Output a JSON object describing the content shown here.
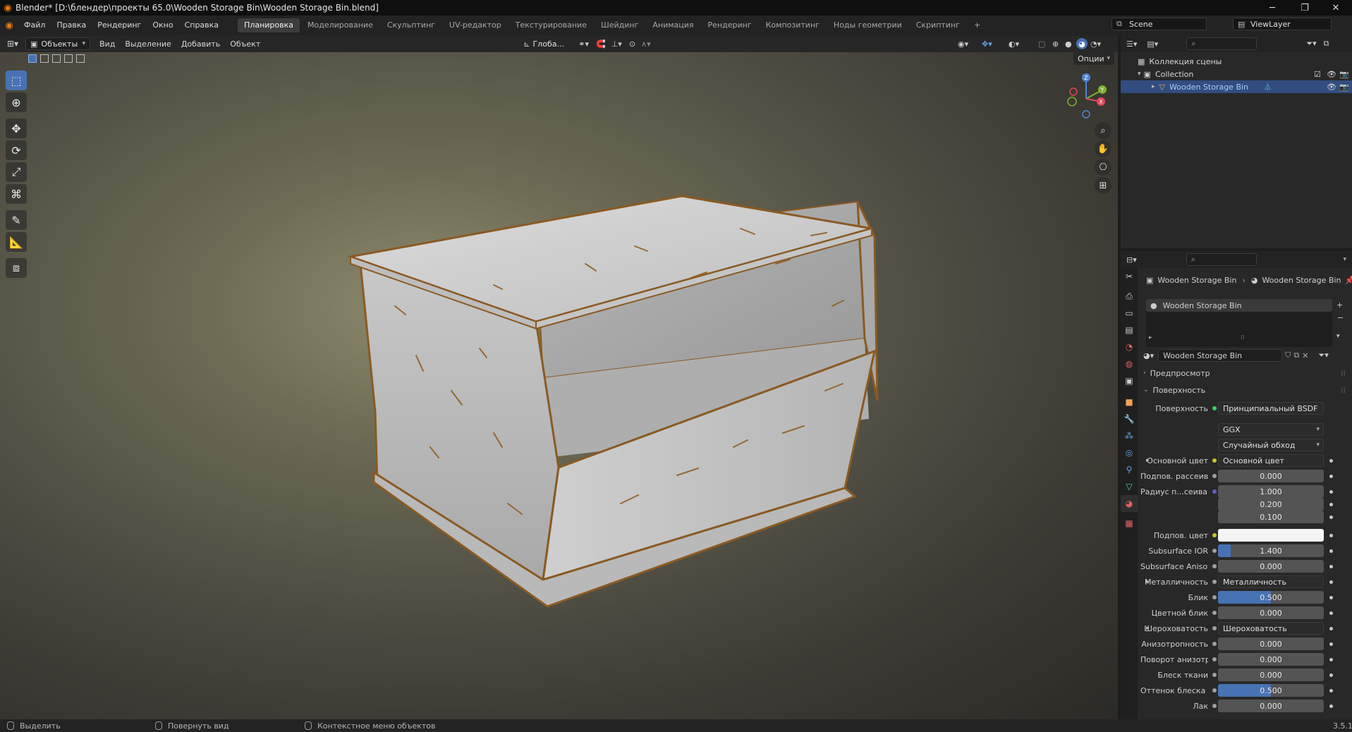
{
  "window": {
    "title": "Blender* [D:\\блендер\\проекты 65.0\\Wooden Storage Bin\\Wooden Storage Bin.blend]",
    "minimize": "─",
    "maximize": "❐",
    "close": "✕"
  },
  "menu": {
    "items": [
      "Файл",
      "Правка",
      "Рендеринг",
      "Окно",
      "Справка"
    ]
  },
  "workspaces": {
    "tabs": [
      "Планировка",
      "Моделирование",
      "Скульптинг",
      "UV-редактор",
      "Текстурирование",
      "Шейдинг",
      "Анимация",
      "Рендеринг",
      "Композитинг",
      "Ноды геометрии",
      "Скриптинг"
    ],
    "active_index": 0,
    "add": "+"
  },
  "scene": {
    "name": "Scene",
    "view_layer": "ViewLayer"
  },
  "viewport_header": {
    "mode": "Объекты",
    "items": [
      "Вид",
      "Выделение",
      "Добавить",
      "Объект"
    ],
    "orientation": "Глоба...",
    "options": "Опции"
  },
  "gizmo": {
    "z": "Z",
    "y": "Y",
    "x": "X"
  },
  "outliner": {
    "root": "Коллекция сцены",
    "collection": "Collection",
    "object": "Wooden Storage Bin"
  },
  "properties": {
    "breadcrumb_object": "Wooden Storage Bin",
    "breadcrumb_material": "Wooden Storage Bin",
    "slot_name": "Wooden Storage Bin",
    "material_name": "Wooden Storage Bin",
    "panel_preview": "Предпросмотр",
    "panel_surface": "Поверхность",
    "surface_label": "Поверхность",
    "surface_value": "Принципиальный BSDF",
    "distribution": "GGX",
    "subsurface_method": "Случайный обход",
    "rows": [
      {
        "label": "Основной цвет",
        "value": "Основной цвет",
        "kind": "link",
        "expand": true,
        "dot": "#c7c729"
      },
      {
        "label": "Подпов. рассеива...",
        "value": "0.000",
        "kind": "num",
        "dot": "#a1a1a1",
        "fill": 0
      },
      {
        "label": "Радиус п...сеивания",
        "value": "1.000",
        "kind": "num",
        "dot": "#6363c7",
        "fill": 0
      },
      {
        "label": "",
        "value": "0.200",
        "kind": "num",
        "fill": 0
      },
      {
        "label": "",
        "value": "0.100",
        "kind": "num",
        "fill": 0
      },
      {
        "label": "Подпов. цвет",
        "value": "",
        "kind": "color",
        "dot": "#c7c729"
      },
      {
        "label": "Subsurface IOR",
        "value": "1.400",
        "kind": "num",
        "dot": "#a1a1a1",
        "fill": 0.12
      },
      {
        "label": "Subsurface Anisotr...",
        "value": "0.000",
        "kind": "num",
        "dot": "#a1a1a1",
        "fill": 0
      },
      {
        "label": "Металличность",
        "value": "Металличность",
        "kind": "link",
        "expand": true,
        "dot": "#a1a1a1"
      },
      {
        "label": "Блик",
        "value": "0.500",
        "kind": "num",
        "dot": "#a1a1a1",
        "fill": 0.5
      },
      {
        "label": "Цветной блик",
        "value": "0.000",
        "kind": "num",
        "dot": "#a1a1a1",
        "fill": 0
      },
      {
        "label": "Шероховатость",
        "value": "Шероховатость",
        "kind": "link",
        "expand": true,
        "dot": "#a1a1a1"
      },
      {
        "label": "Анизотропность",
        "value": "0.000",
        "kind": "num",
        "dot": "#a1a1a1",
        "fill": 0
      },
      {
        "label": "Поворот анизотро...",
        "value": "0.000",
        "kind": "num",
        "dot": "#a1a1a1",
        "fill": 0
      },
      {
        "label": "Блеск ткани",
        "value": "0.000",
        "kind": "num",
        "dot": "#a1a1a1",
        "fill": 0
      },
      {
        "label": "Оттенок блеска тк...",
        "value": "0.500",
        "kind": "num",
        "dot": "#a1a1a1",
        "fill": 0.5
      },
      {
        "label": "Лак",
        "value": "0.000",
        "kind": "num",
        "dot": "#a1a1a1",
        "fill": 0
      }
    ]
  },
  "status": {
    "select": "Выделить",
    "rotate_view": "Повернуть вид",
    "context_menu": "Контекстное меню объектов",
    "version": "3.5.1"
  },
  "colors": {
    "accent": "#4772b3",
    "selected_row": "#334d80",
    "object_text": "#a8cdff"
  }
}
